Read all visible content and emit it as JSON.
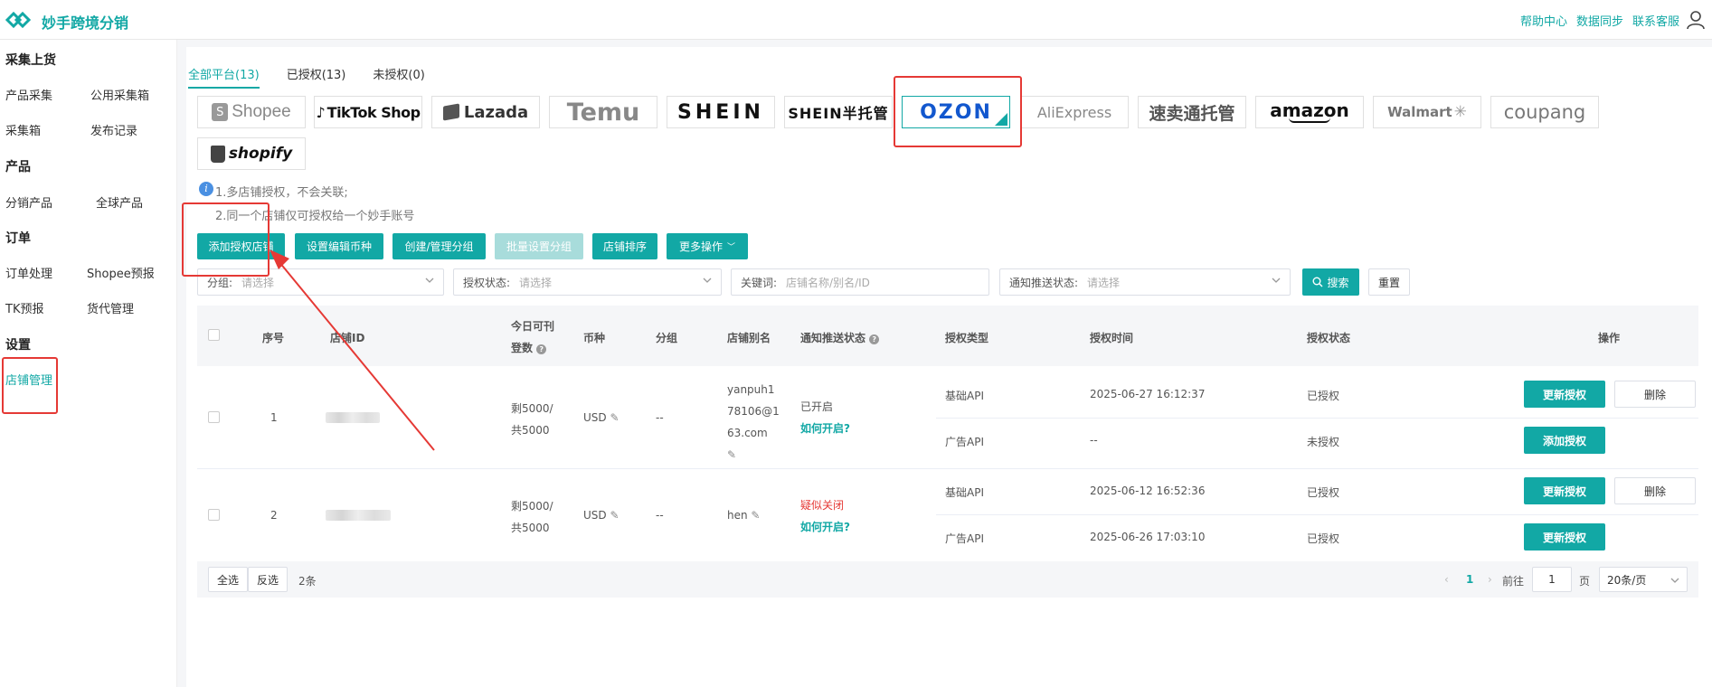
{
  "app": {
    "name": "妙手跨境分销"
  },
  "header": {
    "links": [
      "帮助中心",
      "数据同步",
      "联系客服"
    ]
  },
  "sidebar": {
    "sections": [
      {
        "title": "采集上货",
        "items": [
          "产品采集",
          "公用采集箱",
          "采集箱",
          "发布记录"
        ]
      },
      {
        "title": "产品",
        "items": [
          "分销产品",
          "全球产品"
        ]
      },
      {
        "title": "订单",
        "items": [
          "订单处理",
          "Shopee预报",
          "TK预报",
          "货代管理"
        ]
      },
      {
        "title": "设置",
        "items": [
          "店铺管理"
        ]
      }
    ]
  },
  "tabs": [
    "全部平台(13)",
    "已授权(13)",
    "未授权(0)"
  ],
  "platforms": [
    "Shopee",
    "TikTok Shop",
    "Lazada",
    "Temu",
    "SHEIN",
    "SHEIN半托管",
    "OZON",
    "AliExpress",
    "速卖通托管",
    "amazon",
    "Walmart",
    "coupang",
    "shopify"
  ],
  "tips": [
    "1.多店铺授权，不会关联;",
    "2.同一个店铺仅可授权给一个妙手账号"
  ],
  "toolbar": [
    "添加授权店铺",
    "设置编辑币种",
    "创建/管理分组",
    "批量设置分组",
    "店铺排序",
    "更多操作"
  ],
  "filters": {
    "group_label": "分组:",
    "group_ph": "请选择",
    "auth_label": "授权状态:",
    "auth_ph": "请选择",
    "kw_label": "关键词:",
    "kw_ph": "店铺名称/别名/ID",
    "notify_label": "通知推送状态:",
    "notify_ph": "请选择",
    "search": "搜索",
    "reset": "重置"
  },
  "table": {
    "headers": [
      "序号",
      "店铺ID",
      "今日可刊",
      "登数",
      "币种",
      "分组",
      "店铺别名",
      "通知推送状态",
      "授权类型",
      "授权时间",
      "授权状态",
      "操作"
    ],
    "rows": [
      {
        "no": "1",
        "quota1": "剩5000/",
        "quota2": "共5000",
        "currency": "USD",
        "group": "--",
        "alias": [
          "yanpuh1",
          "78106@1",
          "63.com"
        ],
        "notify": "已开启",
        "howto": "如何开启?",
        "auth": [
          {
            "type": "基础API",
            "time": "2025-06-27 16:12:37",
            "status": "已授权",
            "action": "更新授权",
            "del": "删除"
          },
          {
            "type": "广告API",
            "time": "--",
            "status": "未授权",
            "action": "添加授权"
          }
        ]
      },
      {
        "no": "2",
        "quota1": "剩5000/",
        "quota2": "共5000",
        "currency": "USD",
        "group": "--",
        "alias": [
          "hen"
        ],
        "notify": "疑似关闭",
        "howto": "如何开启?",
        "auth": [
          {
            "type": "基础API",
            "time": "2025-06-12 16:52:36",
            "status": "已授权",
            "action": "更新授权",
            "del": "删除"
          },
          {
            "type": "广告API",
            "time": "2025-06-26 17:03:10",
            "status": "已授权",
            "action": "更新授权"
          }
        ]
      }
    ]
  },
  "footer": {
    "select_all": "全选",
    "invert": "反选",
    "count": "2条",
    "page": "1",
    "goto": "前往",
    "page_input": "1",
    "page_unit": "页",
    "page_size": "20条/页"
  },
  "colors": {
    "accent": "#12a8a5",
    "warn": "#e53935"
  }
}
